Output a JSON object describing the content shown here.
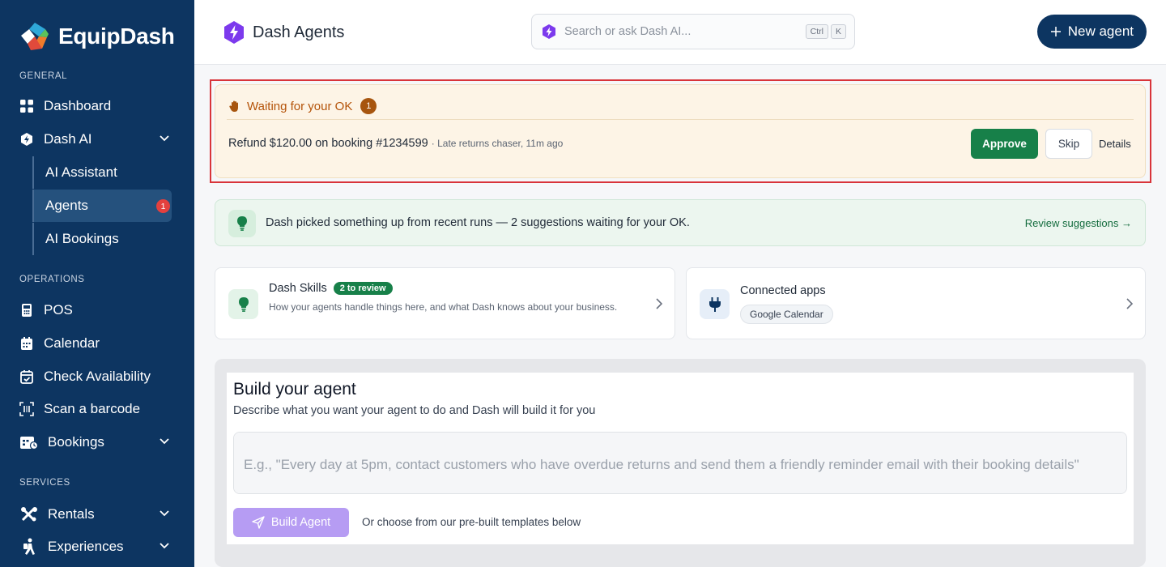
{
  "app": {
    "name": "EquipDash"
  },
  "sidebar": {
    "sections": {
      "general": "GENERAL",
      "operations": "OPERATIONS",
      "services": "SERVICES"
    },
    "items": {
      "dashboard": "Dashboard",
      "dash_ai": "Dash AI",
      "ai_assistant": "AI Assistant",
      "agents": "Agents",
      "agents_badge": "1",
      "ai_bookings": "AI Bookings",
      "pos": "POS",
      "calendar": "Calendar",
      "check_availability": "Check Availability",
      "scan_barcode": "Scan a barcode",
      "bookings": "Bookings",
      "rentals": "Rentals",
      "experiences": "Experiences"
    }
  },
  "header": {
    "title": "Dash Agents",
    "search_placeholder": "Search or ask Dash AI...",
    "shortcut": [
      "Ctrl",
      "K"
    ],
    "new_agent_label": "New agent"
  },
  "approval": {
    "heading": "Waiting for your OK",
    "count": "1",
    "item_text": "Refund $120.00 on booking #1234599",
    "item_meta": "· Late returns chaser, 11m ago",
    "approve_label": "Approve",
    "skip_label": "Skip",
    "details_label": "Details"
  },
  "suggestions": {
    "text": "Dash picked something up from recent runs — 2 suggestions waiting for your OK.",
    "link": "Review suggestions →"
  },
  "skills_card": {
    "title": "Dash Skills",
    "badge": "2 to review",
    "description": "How your agents handle things here, and what Dash knows about your business."
  },
  "apps_card": {
    "title": "Connected apps",
    "chip": "Google Calendar"
  },
  "build": {
    "title": "Build your agent",
    "subtitle": "Describe what you want your agent to do and Dash will build it for you",
    "placeholder": "E.g., \"Every day at 5pm, contact customers who have overdue returns and send them a friendly reminder email with their booking details\"",
    "button_label": "Build Agent",
    "hint": "Or choose from our pre-built templates below"
  },
  "colors": {
    "sidebar_bg": "#0d3561",
    "approve_green": "#178049",
    "warning_orange": "#b45309",
    "alert_red": "#e4403e",
    "build_purple": "#b69cf3"
  }
}
